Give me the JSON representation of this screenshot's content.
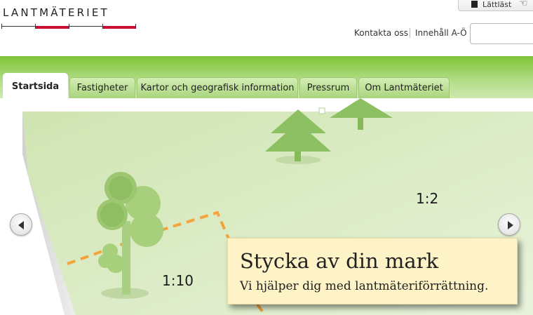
{
  "header": {
    "logo_text": "LANTMÄTERIET",
    "accessibility_label": "Lättläst",
    "links": [
      "Kontakta oss",
      "Innehåll A-Ö"
    ],
    "search": {
      "value": "",
      "placeholder": ""
    }
  },
  "nav": {
    "tabs": [
      {
        "label": "Startsida",
        "active": true
      },
      {
        "label": "Fastigheter",
        "active": false
      },
      {
        "label": "Kartor och geografisk information",
        "active": false
      },
      {
        "label": "Pressrum",
        "active": false
      },
      {
        "label": "Om Lantmäteriet",
        "active": false
      }
    ]
  },
  "hero": {
    "scale_labels": [
      "1:2",
      "1:10"
    ],
    "caption_title": "Stycka av din mark",
    "caption_subtitle": "Vi hjälper dig med lantmäteriförrättning."
  },
  "colors": {
    "brand_red": "#c8102e",
    "nav_green": "#7fc23a",
    "map_green": "#d8eac0",
    "boundary_orange": "#f4a43c",
    "caption_bg": "#fdf3c6"
  },
  "icons": {
    "prev": "chevron-left-icon",
    "next": "chevron-right-icon",
    "easy_read": "easy-read-icon",
    "pointer": "pointer-hand-icon"
  }
}
